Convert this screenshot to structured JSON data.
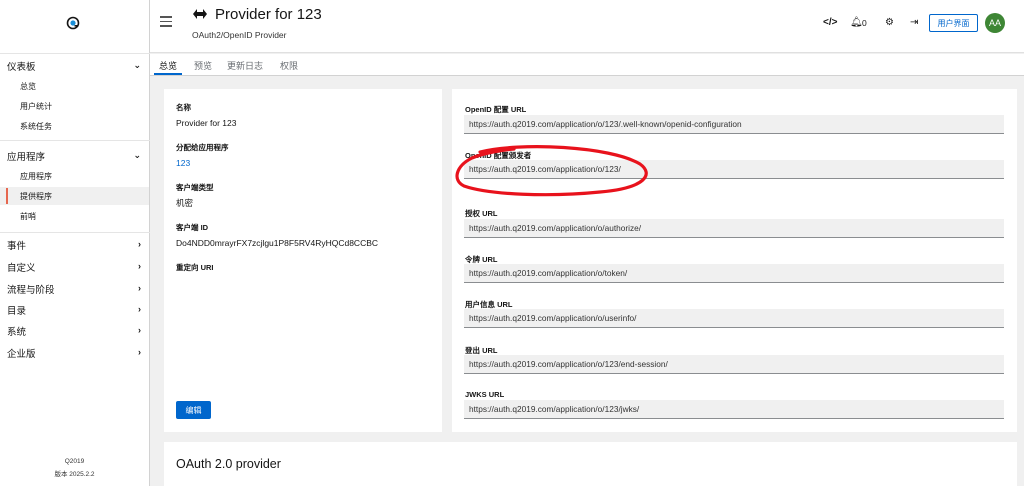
{
  "sidebar": {
    "groups": [
      {
        "label": "仪表板",
        "expanded": true,
        "items": [
          "总览",
          "用户统计",
          "系统任务"
        ]
      },
      {
        "label": "应用程序",
        "expanded": true,
        "items": [
          "应用程序",
          "提供程序",
          "前哨"
        ]
      },
      {
        "label": "事件"
      },
      {
        "label": "自定义"
      },
      {
        "label": "流程与阶段"
      },
      {
        "label": "目录"
      },
      {
        "label": "系统"
      },
      {
        "label": "企业版"
      }
    ],
    "active_item": "提供程序",
    "footer_brand": "Q2019",
    "footer_version": "版本 2025.2.2"
  },
  "header": {
    "title": "Provider for 123",
    "subtitle": "OAuth2/OpenID Provider",
    "notification_count": "0",
    "user_interface_button": "用户界面",
    "avatar_initials": "AA"
  },
  "tabs": [
    {
      "label": "总览",
      "active": true
    },
    {
      "label": "预览"
    },
    {
      "label": "更新日志"
    },
    {
      "label": "权限"
    }
  ],
  "details": {
    "name_label": "名称",
    "name_value": "Provider for 123",
    "assigned_app_label": "分配给应用程序",
    "assigned_app_value": "123",
    "client_type_label": "客户端类型",
    "client_type_value": "机密",
    "client_id_label": "客户端 ID",
    "client_id_value": "Do4NDD0mrayrFX7zcjlgu1P8F5RV4RyHQCd8CCBC",
    "redirect_uri_label": "重定向 URI",
    "edit_button": "编辑"
  },
  "urls": [
    {
      "label": "OpenID 配置 URL",
      "value": "https://auth.q2019.com/application/o/123/.well-known/openid-configuration"
    },
    {
      "label": "OpenID 配置颁发者",
      "value": "https://auth.q2019.com/application/o/123/"
    },
    {
      "label": "授权 URL",
      "value": "https://auth.q2019.com/application/o/authorize/"
    },
    {
      "label": "令牌 URL",
      "value": "https://auth.q2019.com/application/o/token/"
    },
    {
      "label": "用户信息 URL",
      "value": "https://auth.q2019.com/application/o/userinfo/"
    },
    {
      "label": "登出 URL",
      "value": "https://auth.q2019.com/application/o/123/end-session/"
    },
    {
      "label": "JWKS URL",
      "value": "https://auth.q2019.com/application/o/123/jwks/"
    }
  ],
  "bottom_card_title": "OAuth 2.0 provider",
  "colors": {
    "accent": "#0066cc",
    "annotation": "#e8121c",
    "avatar": "#3e8635",
    "active_bar": "#e6674f"
  },
  "icons": [
    "logo-icon",
    "menu-icon",
    "provider-icon",
    "code-icon",
    "bell-icon",
    "gear-icon",
    "logout-icon",
    "chevron-down-icon",
    "chevron-right-icon"
  ]
}
